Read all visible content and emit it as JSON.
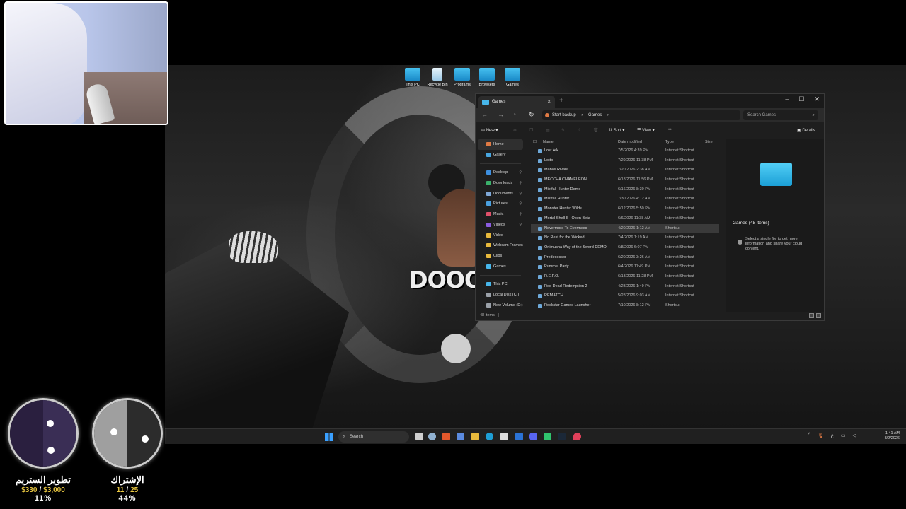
{
  "desktop_icons": [
    {
      "label": "This PC",
      "icon": "monitor-icon"
    },
    {
      "label": "Recycle Bin",
      "icon": "recycle-bin-icon"
    },
    {
      "label": "Programs",
      "icon": "folder-icon"
    },
    {
      "label": "Browsers",
      "icon": "folder-icon"
    },
    {
      "label": "Games",
      "icon": "folder-icon"
    }
  ],
  "wallpaper": {
    "logo_text": "DOOO"
  },
  "explorer": {
    "tab_title": "Games",
    "breadcrumb": [
      "Start backup",
      "Games"
    ],
    "search_placeholder": "Search Games",
    "toolbar": {
      "new": "New",
      "sort": "Sort",
      "view": "View",
      "more": "•••",
      "details": "Details"
    },
    "nav": [
      {
        "label": "Home",
        "icon": "home-icon",
        "color": "#e07a44",
        "active": true
      },
      {
        "label": "Gallery",
        "icon": "gallery-icon",
        "color": "#48a6e0"
      },
      {
        "label": "Desktop",
        "icon": "desktop-icon",
        "color": "#3d8fe0",
        "pinned": true
      },
      {
        "label": "Downloads",
        "icon": "download-icon",
        "color": "#3ab06a",
        "pinned": true
      },
      {
        "label": "Documents",
        "icon": "document-icon",
        "color": "#7fa8d8",
        "pinned": true
      },
      {
        "label": "Pictures",
        "icon": "picture-icon",
        "color": "#4aa0e0",
        "pinned": true
      },
      {
        "label": "Music",
        "icon": "music-icon",
        "color": "#e0506a",
        "pinned": true
      },
      {
        "label": "Videos",
        "icon": "video-icon",
        "color": "#8b5ce0",
        "pinned": true
      },
      {
        "label": "Video",
        "icon": "folder-icon",
        "color": "#e8b93c"
      },
      {
        "label": "Webcam Frames",
        "icon": "folder-icon",
        "color": "#e8b93c"
      },
      {
        "label": "Clips",
        "icon": "folder-icon",
        "color": "#e8b93c"
      },
      {
        "label": "Games",
        "icon": "folder-icon",
        "color": "#47b6ea"
      },
      {
        "label": "This PC",
        "icon": "monitor-icon",
        "color": "#47b6ea"
      },
      {
        "label": "Local Disk (C:)",
        "icon": "drive-icon",
        "color": "#9aa0a8"
      },
      {
        "label": "New Volume (D:)",
        "icon": "drive-icon",
        "color": "#9aa0a8"
      }
    ],
    "columns": {
      "name": "Name",
      "date": "Date modified",
      "type": "Type",
      "size": "Size"
    },
    "files": [
      {
        "name": "Lost Ark",
        "date": "7/5/2026 4:39 PM",
        "type": "Internet Shortcut"
      },
      {
        "name": "Lotto",
        "date": "7/29/2026 11:38 PM",
        "type": "Internet Shortcut"
      },
      {
        "name": "Marvel Rivals",
        "date": "7/20/2026 2:38 AM",
        "type": "Internet Shortcut"
      },
      {
        "name": "MECCHA CHAMELEON",
        "date": "6/18/2026 11:56 PM",
        "type": "Internet Shortcut"
      },
      {
        "name": "Mistfall Hunter Demo",
        "date": "6/16/2026 8:30 PM",
        "type": "Internet Shortcut"
      },
      {
        "name": "Mistfall Hunter",
        "date": "7/30/2026 4:12 AM",
        "type": "Internet Shortcut"
      },
      {
        "name": "Monster Hunter Wilds",
        "date": "6/12/2026 5:50 PM",
        "type": "Internet Shortcut"
      },
      {
        "name": "Mortal Shell II - Open Beta",
        "date": "6/6/2026 11:38 AM",
        "type": "Internet Shortcut"
      },
      {
        "name": "Nevermore To Evermess",
        "date": "4/20/2026 1:12 AM",
        "type": "Shortcut",
        "selected": true
      },
      {
        "name": "No Rest for the Wicked",
        "date": "7/4/2026 1:19 AM",
        "type": "Internet Shortcut"
      },
      {
        "name": "Onimusha Way of the Sword DEMO",
        "date": "6/8/2026 6:07 PM",
        "type": "Internet Shortcut"
      },
      {
        "name": "Predecessor",
        "date": "6/20/2026 3:26 AM",
        "type": "Internet Shortcut"
      },
      {
        "name": "Pummel Party",
        "date": "6/4/2026 11:49 PM",
        "type": "Internet Shortcut"
      },
      {
        "name": "R.E.P.O.",
        "date": "6/13/2026 11:28 PM",
        "type": "Internet Shortcut"
      },
      {
        "name": "Red Dead Redemption 2",
        "date": "4/23/2026 1:49 PM",
        "type": "Internet Shortcut"
      },
      {
        "name": "REMATCH",
        "date": "5/28/2026 9:03 AM",
        "type": "Internet Shortcut"
      },
      {
        "name": "Rockstar Games Launcher",
        "date": "7/10/2026 8:12 PM",
        "type": "Shortcut"
      }
    ],
    "details_pane": {
      "title": "Games (48 items)",
      "hint": "Select a single file to get more information and share your cloud content."
    },
    "status": "48 items"
  },
  "taskbar": {
    "search_label": "Search",
    "time": "1:41 AM",
    "date": "8/2/2026",
    "lang": "ع"
  },
  "goals": [
    {
      "title": "تطوير الستريم",
      "current": "$330",
      "target": "$3,000",
      "percent": "11%"
    },
    {
      "title": "الإشتراك",
      "current": "11",
      "target": "25",
      "percent": "44%"
    }
  ]
}
